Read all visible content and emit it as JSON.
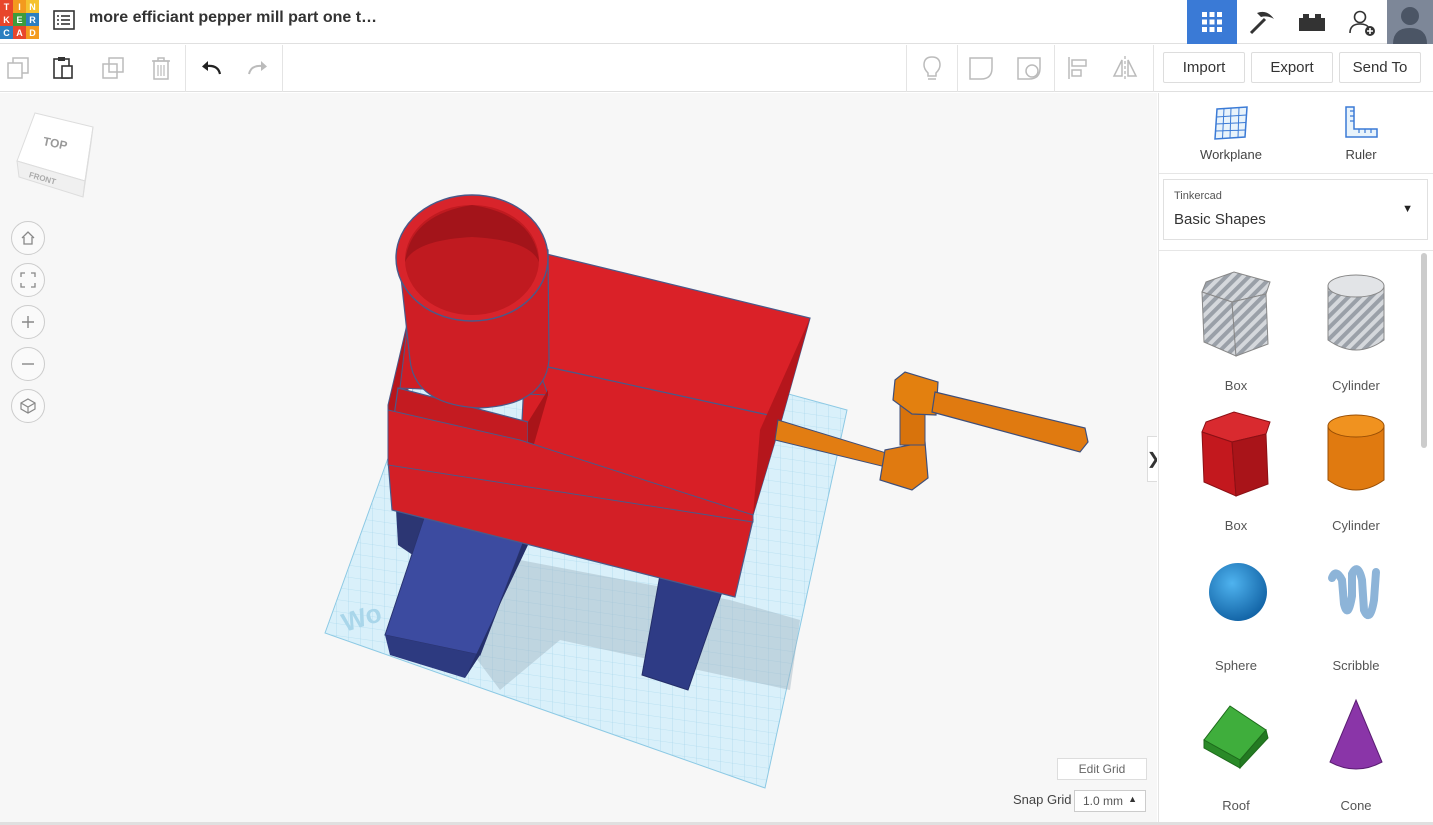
{
  "header": {
    "logo_letters": [
      "T",
      "I",
      "N",
      "K",
      "E",
      "R",
      "C",
      "A",
      "D"
    ],
    "logo_colors": [
      "#e8462b",
      "#f39a1e",
      "#f5c230",
      "#e8462b",
      "#3d9c3c",
      "#2b7fc0",
      "#2b7fc0",
      "#e8462b",
      "#f39a1e"
    ],
    "title": "more efficiant pepper mill part one t…",
    "icons": [
      "grid-view-icon",
      "pickaxe-icon",
      "brick-icon",
      "add-user-icon",
      "avatar"
    ]
  },
  "toolbar": {
    "left_tools": [
      "copy-icon",
      "paste-icon",
      "duplicate-icon",
      "delete-icon",
      "undo-icon",
      "redo-icon"
    ],
    "right_tools": [
      "lightbulb-icon",
      "shape-icon",
      "hole-icon",
      "align-icon",
      "mirror-icon"
    ],
    "import_label": "Import",
    "export_label": "Export",
    "send_to_label": "Send To"
  },
  "viewcube": {
    "top": "TOP",
    "front": "FRONT"
  },
  "workplane_text": "Wo",
  "canvas": {
    "edit_grid_label": "Edit Grid",
    "snap_label": "Snap Grid",
    "snap_value": "1.0 mm",
    "collapse_glyph": "❯"
  },
  "panel": {
    "workplane_label": "Workplane",
    "ruler_label": "Ruler",
    "library_source": "Tinkercad",
    "library_name": "Basic Shapes",
    "shapes": [
      {
        "label": "Box",
        "icon": "box-hole-icon"
      },
      {
        "label": "Cylinder",
        "icon": "cylinder-hole-icon"
      },
      {
        "label": "Box",
        "icon": "box-icon"
      },
      {
        "label": "Cylinder",
        "icon": "cylinder-icon"
      },
      {
        "label": "Sphere",
        "icon": "sphere-icon"
      },
      {
        "label": "Scribble",
        "icon": "scribble-icon"
      },
      {
        "label": "Roof",
        "icon": "roof-icon"
      },
      {
        "label": "Cone",
        "icon": "cone-icon"
      }
    ]
  },
  "colors": {
    "accent": "#3a7ad6",
    "red_part": "#d81f26",
    "blue_part": "#3a4a9e",
    "orange_part": "#e07a10",
    "grid": "#bfe6f5"
  }
}
